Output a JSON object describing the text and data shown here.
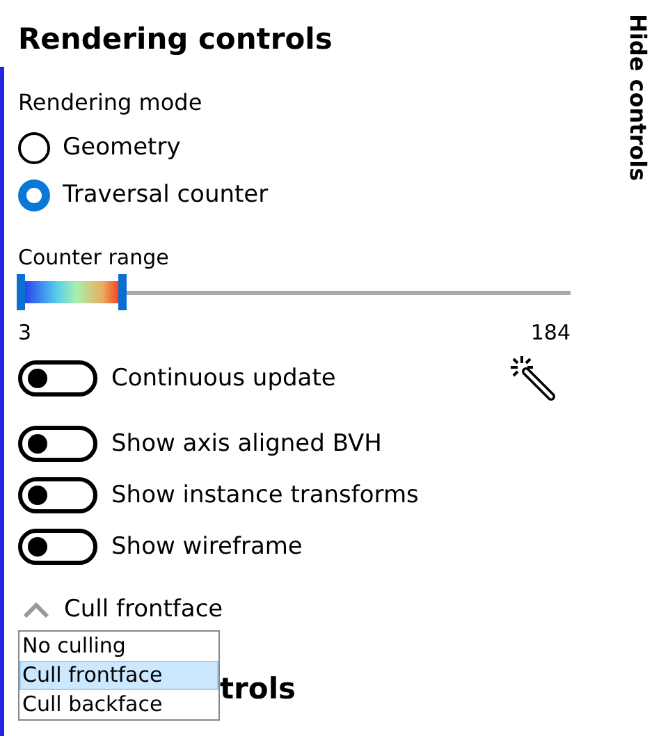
{
  "title": "Rendering controls",
  "hide_button": {
    "label": "Hide controls"
  },
  "rendering_mode": {
    "label": "Rendering mode",
    "options": [
      {
        "label": "Geometry",
        "selected": false
      },
      {
        "label": "Traversal counter",
        "selected": true
      }
    ]
  },
  "counter_range": {
    "label": "Counter range",
    "level": 0.185,
    "min": "3",
    "max": "184"
  },
  "toggles": [
    {
      "label": "Continuous update",
      "on": false
    },
    {
      "label": "Show axis aligned BVH",
      "on": false
    },
    {
      "label": "Show instance transforms",
      "on": false
    },
    {
      "label": "Show wireframe",
      "on": false
    }
  ],
  "culling": {
    "label": "Cull frontface",
    "expanded": true,
    "options": [
      {
        "label": "No culling",
        "selected": false
      },
      {
        "label": "Cull frontface",
        "selected": true
      },
      {
        "label": "Cull backface",
        "selected": false
      }
    ]
  },
  "next_heading": "trols"
}
